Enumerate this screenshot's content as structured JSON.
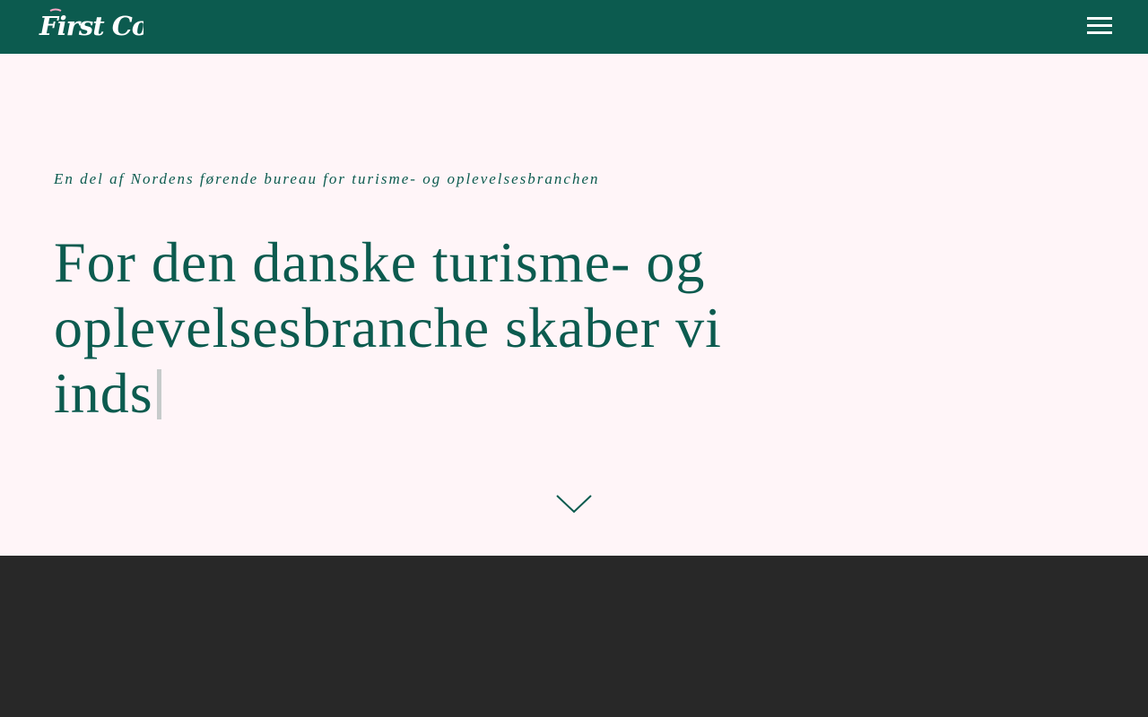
{
  "header": {
    "logo_text": "First Coffee",
    "logo_icon": "first-coffee-logo",
    "menu_icon": "hamburger-menu-icon",
    "background_color": "#0c5b4f"
  },
  "hero": {
    "tagline": "En del af Nordens førende bureau for turisme- og oplevelsesbranchen",
    "headline": "For den danske turisme- og oplevelsesbranche skaber vi inds",
    "scroll_icon": "chevron-down-icon",
    "background_color": "#fff5f8",
    "text_color": "#0c5b4f"
  },
  "footer_section": {
    "background_color": "#282828"
  }
}
